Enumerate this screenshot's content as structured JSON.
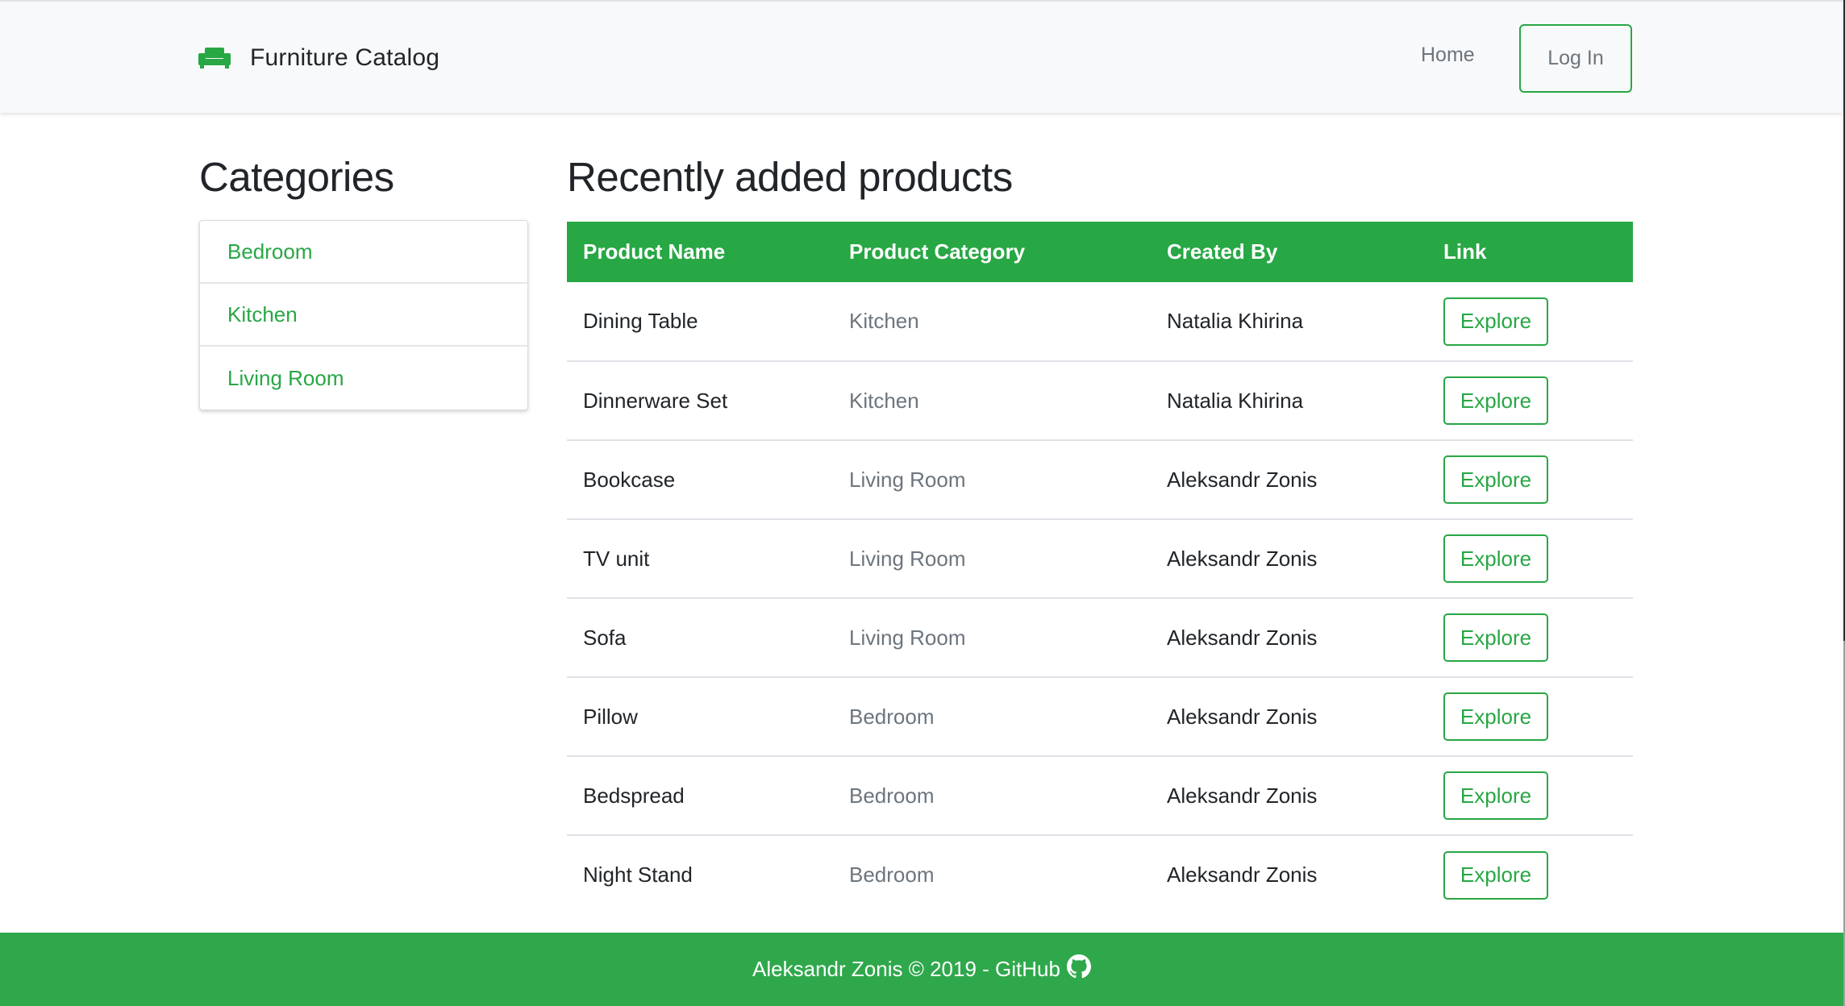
{
  "navbar": {
    "brand": "Furniture Catalog",
    "brand_icon": "couch-icon",
    "home_label": "Home",
    "login_label": "Log In"
  },
  "sidebar": {
    "title": "Categories",
    "items": [
      {
        "label": "Bedroom"
      },
      {
        "label": "Kitchen"
      },
      {
        "label": "Living Room"
      }
    ]
  },
  "main": {
    "title": "Recently added products",
    "columns": [
      "Product Name",
      "Product Category",
      "Created By",
      "Link"
    ],
    "rows": [
      {
        "name": "Dining Table",
        "category": "Kitchen",
        "created_by": "Natalia Khirina",
        "link": "Explore"
      },
      {
        "name": "Dinnerware Set",
        "category": "Kitchen",
        "created_by": "Natalia Khirina",
        "link": "Explore"
      },
      {
        "name": "Bookcase",
        "category": "Living Room",
        "created_by": "Aleksandr Zonis",
        "link": "Explore"
      },
      {
        "name": "TV unit",
        "category": "Living Room",
        "created_by": "Aleksandr Zonis",
        "link": "Explore"
      },
      {
        "name": "Sofa",
        "category": "Living Room",
        "created_by": "Aleksandr Zonis",
        "link": "Explore"
      },
      {
        "name": "Pillow",
        "category": "Bedroom",
        "created_by": "Aleksandr Zonis",
        "link": "Explore"
      },
      {
        "name": "Bedspread",
        "category": "Bedroom",
        "created_by": "Aleksandr Zonis",
        "link": "Explore"
      },
      {
        "name": "Night Stand",
        "category": "Bedroom",
        "created_by": "Aleksandr Zonis",
        "link": "Explore"
      }
    ]
  },
  "footer": {
    "text": "Aleksandr Zonis © 2019 - ",
    "link_label": "GitHub",
    "link_icon": "github-icon"
  },
  "colors": {
    "accent": "#28a745",
    "navbar_bg": "#f8f9fa",
    "muted": "#6c757d"
  }
}
